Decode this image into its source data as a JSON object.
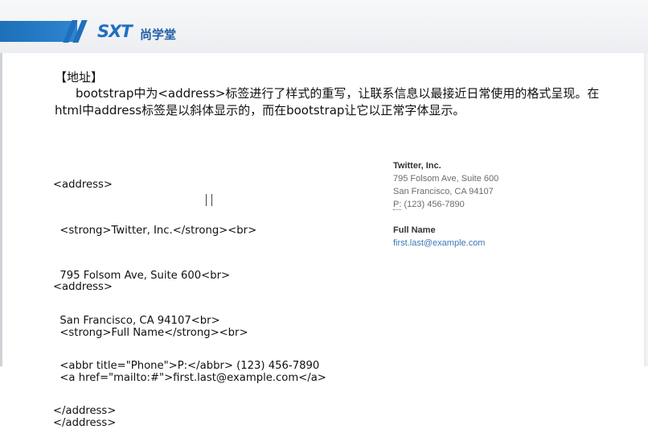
{
  "brand": {
    "logo_text": "SXT",
    "logo_cn": "尚学堂"
  },
  "slide": {
    "title": "【地址】",
    "description": "bootstrap中为<address>标签进行了样式的重写，让联系信息以最接近日常使用的格式呈现。在html中address标签是以斜体显示的，而在bootstrap让它以正常字体显示。"
  },
  "code_blocks": [
    {
      "lines": [
        "<address>",
        "  <strong>Twitter, Inc.</strong><br>",
        "  795 Folsom Ave, Suite 600<br>",
        "  San Francisco, CA 94107<br>",
        "  <abbr title=\"Phone\">P:</abbr> (123) 456-7890",
        "</address>"
      ]
    },
    {
      "lines": [
        "<address>",
        "  <strong>Full Name</strong><br>",
        "  <a href=\"mailto:#\">first.last@example.com</a>",
        "</address>"
      ]
    }
  ],
  "rendered_preview": {
    "address1": {
      "name": "Twitter, Inc.",
      "street": "795 Folsom Ave, Suite 600",
      "city": "San Francisco, CA 94107",
      "phone_abbr": "P:",
      "phone": " (123) 456-7890"
    },
    "address2": {
      "name": "Full Name",
      "email": "first.last@example.com"
    }
  },
  "colors": {
    "brand_blue": "#1f6fbe",
    "link_blue": "#3a78b8",
    "muted_text": "#6b6b6b"
  }
}
